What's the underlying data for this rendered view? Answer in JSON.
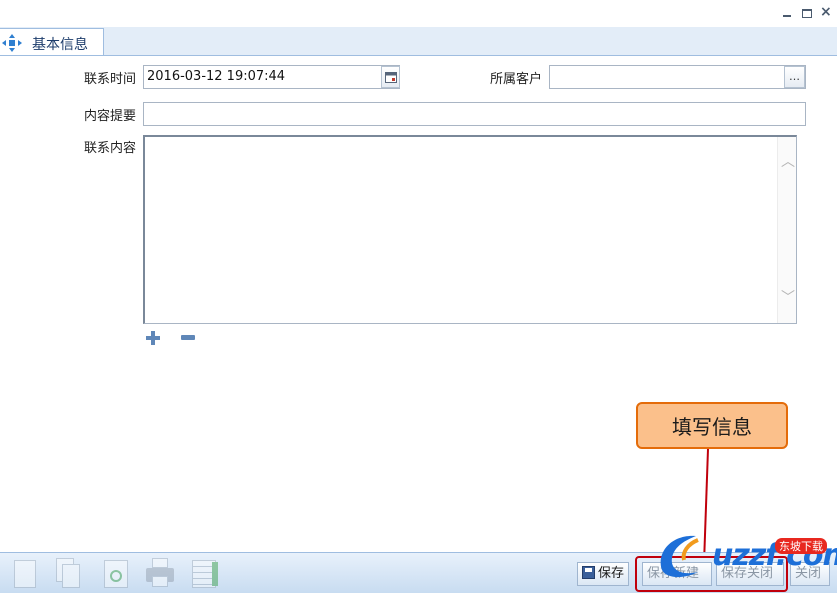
{
  "window": {
    "controls": {
      "minimize_icon": "minimize-icon",
      "restore_icon": "restore-icon",
      "close_icon": "close-icon",
      "close_glyph": "×"
    }
  },
  "tab": {
    "label": "基本信息",
    "icon": "expand-arrows-icon"
  },
  "form": {
    "contact_time_label": "联系时间",
    "contact_time_value": "2016-03-12 19:07:44",
    "customer_label": "所属客户",
    "customer_value": "",
    "customer_picker_label": "…",
    "summary_label": "内容提要",
    "summary_value": "",
    "content_label": "联系内容",
    "content_value": ""
  },
  "annotation": {
    "callout_text": "填写信息"
  },
  "toolbar": {
    "save_label": "保存",
    "save_new_label": "保存新建",
    "save_close_label": "保存关闭",
    "close_label": "关闭"
  },
  "watermark": {
    "text": "uzzf.com",
    "badge": "东坡下载"
  },
  "colors": {
    "accent": "#1d3c6b",
    "callout_fill": "#fbc08b",
    "callout_border": "#e46c0a",
    "highlight_red": "#c0000c"
  }
}
